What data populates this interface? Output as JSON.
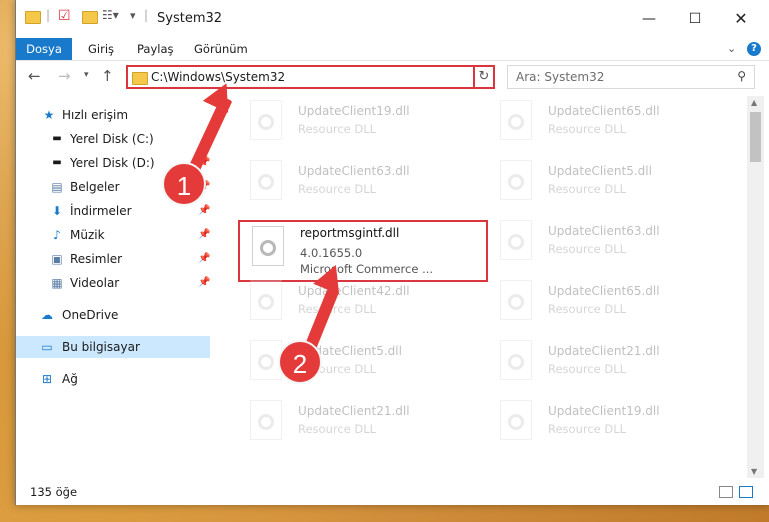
{
  "window": {
    "title": "System32"
  },
  "ribbon": {
    "tabs": [
      "Dosya",
      "Giriş",
      "Paylaş",
      "Görünüm"
    ],
    "help": "?"
  },
  "address": {
    "path": "C:\\Windows\\System32"
  },
  "search": {
    "placeholder": "Ara: System32"
  },
  "sidebar": {
    "items": [
      {
        "label": "Hızlı erişim",
        "icon": "star-icon"
      },
      {
        "label": "Yerel Disk (C:)",
        "icon": "drive-icon"
      },
      {
        "label": "Yerel Disk (D:)",
        "icon": "drive-icon"
      },
      {
        "label": "Belgeler",
        "icon": "documents-icon"
      },
      {
        "label": "İndirmeler",
        "icon": "download-icon"
      },
      {
        "label": "Müzik",
        "icon": "music-icon"
      },
      {
        "label": "Resimler",
        "icon": "pictures-icon"
      },
      {
        "label": "Videolar",
        "icon": "videos-icon"
      },
      {
        "label": "OneDrive",
        "icon": "cloud-icon"
      },
      {
        "label": "Bu bilgisayar",
        "icon": "computer-icon"
      },
      {
        "label": "Ağ",
        "icon": "network-icon"
      }
    ]
  },
  "files": [
    {
      "name": "UpdateClient19.dll",
      "type": "Resource DLL"
    },
    {
      "name": "UpdateClient65.dll",
      "type": "Resource DLL"
    },
    {
      "name": "UpdateClient63.dll",
      "type": "Resource DLL"
    },
    {
      "name": "UpdateClient5.dll",
      "type": "Resource DLL"
    },
    {
      "name": "reportmsgintf.dll",
      "version": "4.0.1655.0",
      "description": "Microsoft Commerce ..."
    },
    {
      "name": "UpdateClient63.dll",
      "type": "Resource DLL"
    },
    {
      "name": "UpdateClient42.dll",
      "type": "Resource DLL"
    },
    {
      "name": "UpdateClient65.dll",
      "type": "Resource DLL"
    },
    {
      "name": "UpdateClient5.dll",
      "type": "Resource DLL"
    },
    {
      "name": "UpdateClient21.dll",
      "type": "Resource DLL"
    },
    {
      "name": "UpdateClient21.dll",
      "type": "Resource DLL"
    },
    {
      "name": "UpdateClient19.dll",
      "type": "Resource DLL"
    }
  ],
  "status": {
    "count": "135 öğe"
  },
  "annotations": {
    "step1": "1",
    "step2": "2"
  },
  "colors": {
    "accent": "#1979ca",
    "highlight": "#d9363e",
    "annotation": "#e53a3a"
  }
}
